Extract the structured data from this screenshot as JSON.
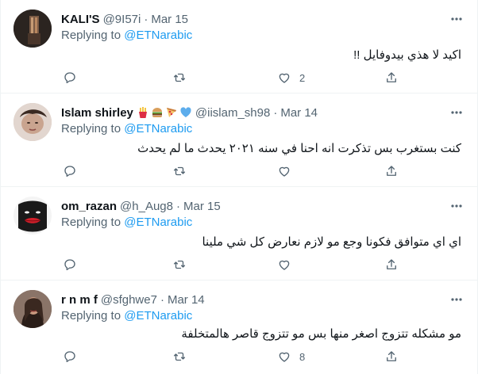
{
  "tweets": [
    {
      "name": "KALI'S",
      "handle": "@9I57i",
      "dot": "·",
      "time": "Mar 15",
      "reply_prefix": "Replying to ",
      "reply_to": "@ETNarabic",
      "text": "اكيد لا هذي بيدوفايل !!",
      "likes": "2",
      "avatar_icon": "dark-window-photo"
    },
    {
      "name": "Islam shirley",
      "emojis": [
        "fries",
        "burger",
        "pizza",
        "blue-heart"
      ],
      "handle": "@iislam_sh98",
      "dot": "·",
      "time": "Mar 14",
      "reply_prefix": "Replying to ",
      "reply_to": "@ETNarabic",
      "text": "كنت بستغرب  بس  تذكرت انه احنا في سنه ٢٠٢١ يحدث ما لم يحدث",
      "likes": "",
      "avatar_icon": "person-photo"
    },
    {
      "name": "om_razan",
      "handle": "@h_Aug8",
      "dot": "·",
      "time": "Mar 15",
      "reply_prefix": "Replying to ",
      "reply_to": "@ETNarabic",
      "text": "اي اي متوافق فكونا وجع مو لازم نعارض كل شي ملينا",
      "likes": "",
      "avatar_icon": "red-lips-photo"
    },
    {
      "name": "r n m f",
      "handle": "@sfghwe7",
      "dot": "·",
      "time": "Mar 14",
      "reply_prefix": "Replying to ",
      "reply_to": "@ETNarabic",
      "text": "مو مشكله تتزوج اصغر منها بس مو تتزوج قاصر هالمتخلفة",
      "likes": "8",
      "avatar_icon": "woman-photo"
    }
  ],
  "colors": {
    "text": "#0f1419",
    "secondary": "#536471",
    "accent": "#1d9bf0",
    "border": "#eff3f4"
  }
}
